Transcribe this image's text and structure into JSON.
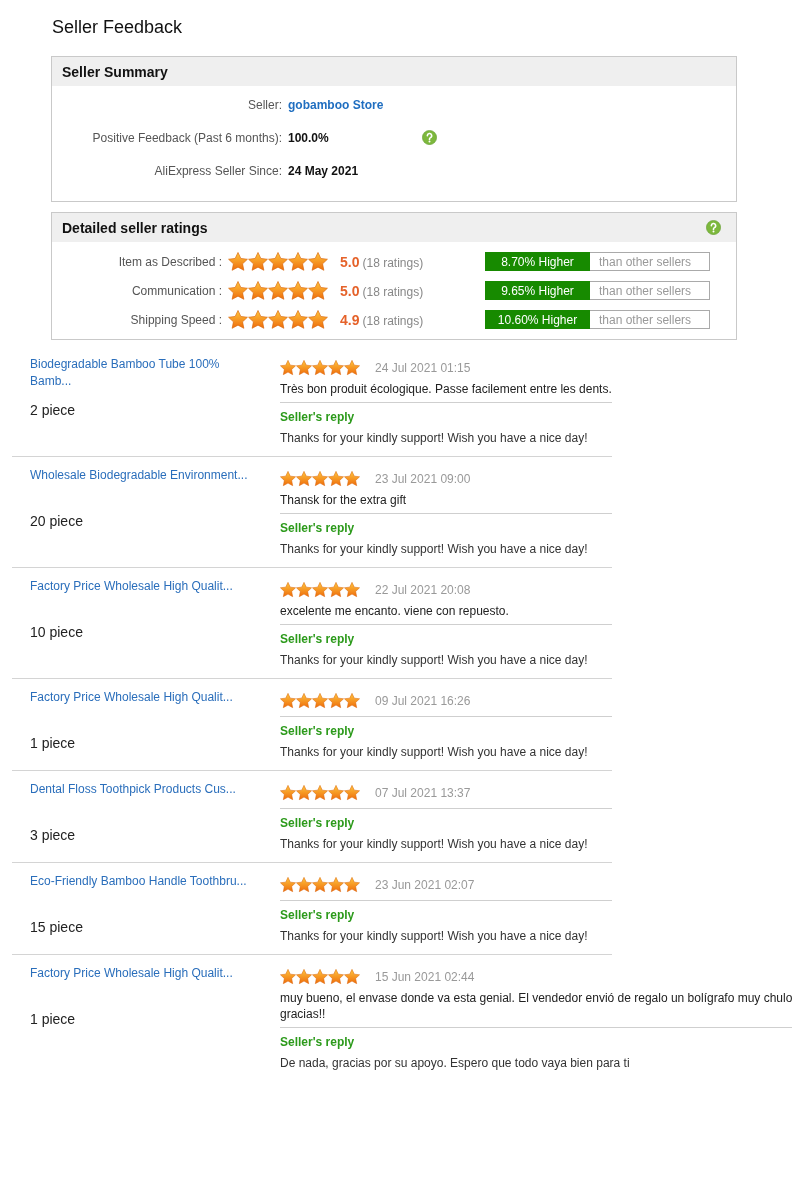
{
  "page": {
    "title": "Seller Feedback"
  },
  "seller_summary": {
    "title": "Seller Summary",
    "rows": [
      {
        "label": "Seller:",
        "value": "gobamboo Store",
        "kind": "link",
        "help": false
      },
      {
        "label": "Positive Feedback (Past 6 months):",
        "value": "100.0%",
        "kind": "text",
        "help": true
      },
      {
        "label": "AliExpress Seller Since:",
        "value": "24 May 2021",
        "kind": "text",
        "help": false
      }
    ]
  },
  "detailed_ratings": {
    "title": "Detailed seller ratings",
    "help": true,
    "rows": [
      {
        "label": "Item as Described :",
        "stars": 5,
        "score": "5.0",
        "count": "(18 ratings)",
        "comparison": "8.70% Higher",
        "comparison_note": "than other sellers"
      },
      {
        "label": "Communication :",
        "stars": 5,
        "score": "5.0",
        "count": "(18 ratings)",
        "comparison": "9.65% Higher",
        "comparison_note": "than other sellers"
      },
      {
        "label": "Shipping Speed :",
        "stars": 5,
        "score": "4.9",
        "count": "(18 ratings)",
        "comparison": "10.60% Higher",
        "comparison_note": "than other sellers"
      }
    ]
  },
  "reviews": [
    {
      "product": "Biodegradable Bamboo Tube 100% Bamb...",
      "quantity": "2 piece",
      "stars": 5,
      "date": "24 Jul 2021 01:15",
      "comment": "Très bon produit écologique. Passe facilement entre les dents.",
      "reply_label": "Seller's reply",
      "reply": "Thanks for your kindly support! Wish you have a nice day!"
    },
    {
      "product": "Wholesale Biodegradable Environment...",
      "quantity": "20 piece",
      "stars": 5,
      "date": "23 Jul 2021 09:00",
      "comment": "Thansk for the extra gift",
      "reply_label": "Seller's reply",
      "reply": "Thanks for your kindly support! Wish you have a nice day!"
    },
    {
      "product": "Factory Price Wholesale High Qualit...",
      "quantity": "10 piece",
      "stars": 5,
      "date": "22 Jul 2021 20:08",
      "comment": "excelente me encanto. viene con repuesto.",
      "reply_label": "Seller's reply",
      "reply": "Thanks for your kindly support! Wish you have a nice day!"
    },
    {
      "product": "Factory Price Wholesale High Qualit...",
      "quantity": "1 piece",
      "stars": 5,
      "date": "09 Jul 2021 16:26",
      "reply_label": "Seller's reply",
      "reply": "Thanks for your kindly support! Wish you have a nice day!"
    },
    {
      "product": "Dental Floss Toothpick Products Cus...",
      "quantity": "3 piece",
      "stars": 5,
      "date": "07 Jul 2021 13:37",
      "reply_label": "Seller's reply",
      "reply": "Thanks for your kindly support! Wish you have a nice day!"
    },
    {
      "product": "Eco-Friendly Bamboo Handle Toothbru...",
      "quantity": "15 piece",
      "stars": 5,
      "date": "23 Jun 2021 02:07",
      "reply_label": "Seller's reply",
      "reply": "Thanks for your kindly support! Wish you have a nice day!"
    },
    {
      "product": "Factory Price Wholesale High Qualit...",
      "quantity": "1 piece",
      "stars": 5,
      "date": "15 Jun 2021 02:44",
      "comment": "muy bueno, el envase donde va esta genial. El vendedor envió de regalo un bolígrafo muy chulo\ngracias!!",
      "reply_label": "Seller's reply",
      "reply": "De nada, gracias por su apoyo. Espero que todo vaya bien para ti"
    }
  ]
}
